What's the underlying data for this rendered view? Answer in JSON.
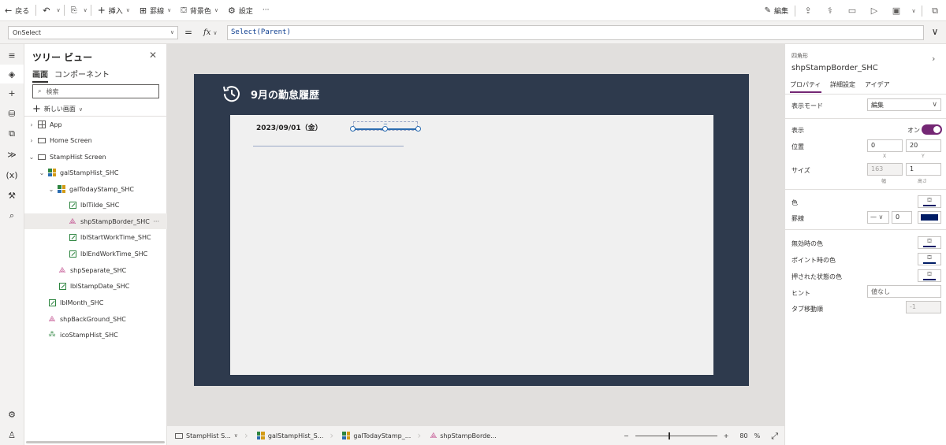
{
  "toolbar": {
    "back": "戻る",
    "insert": "挿入",
    "border": "罫線",
    "background_color": "背景色",
    "settings": "設定",
    "more": "···",
    "edit": "編集"
  },
  "formula_bar": {
    "property": "OnSelect",
    "equals": "=",
    "fx": "fx",
    "formula": "Select(Parent)"
  },
  "tree_view": {
    "title": "ツリー ビュー",
    "tabs": [
      "画面",
      "コンポーネント"
    ],
    "search_placeholder": "検索",
    "new_screen": "新しい画面",
    "items": [
      {
        "label": "App",
        "icon": "app"
      },
      {
        "label": "Home Screen",
        "icon": "screen"
      },
      {
        "label": "StampHist Screen",
        "icon": "screen"
      },
      {
        "label": "galStampHist_SHC",
        "icon": "gallery"
      },
      {
        "label": "galTodayStamp_SHC",
        "icon": "gallery"
      },
      {
        "label": "lblTilde_SHC",
        "icon": "label"
      },
      {
        "label": "shpStampBorder_SHC",
        "icon": "shape",
        "more": "···"
      },
      {
        "label": "lblStartWorkTime_SHC",
        "icon": "label"
      },
      {
        "label": "lblEndWorkTime_SHC",
        "icon": "label"
      },
      {
        "label": "shpSeparate_SHC",
        "icon": "shape"
      },
      {
        "label": "lblStampDate_SHC",
        "icon": "label"
      },
      {
        "label": "lblMonth_SHC",
        "icon": "label"
      },
      {
        "label": "shpBackGround_SHC",
        "icon": "shape"
      },
      {
        "label": "icoStampHist_SHC",
        "icon": "icon"
      }
    ]
  },
  "canvas": {
    "title": "9月の勤怠履歴",
    "stamp_date": "2023/09/01（金）",
    "tilde": "~"
  },
  "breadcrumbs": [
    "StampHist S...",
    "galStampHist_S...",
    "galTodayStamp_...",
    "shpStampBorde..."
  ],
  "zoom": {
    "minus": "−",
    "plus": "+",
    "value": "80",
    "unit": "%"
  },
  "properties": {
    "control_type": "四角形",
    "control_name": "shpStampBorder_SHC",
    "tabs": [
      "プロパティ",
      "詳細設定",
      "アイデア"
    ],
    "display_mode_label": "表示モード",
    "display_mode_value": "編集",
    "visible_label": "表示",
    "visible_state": "オン",
    "position_label": "位置",
    "x_value": "0",
    "y_value": "20",
    "x_caption": "X",
    "y_caption": "Y",
    "size_label": "サイズ",
    "width_value": "163",
    "height_value": "1",
    "width_caption": "幅",
    "height_caption": "高さ",
    "color_label": "色",
    "border_label": "罫線",
    "border_width": "0",
    "border_color": "#001c65",
    "disabled_color_label": "無効時の色",
    "hover_color_label": "ポイント時の色",
    "pressed_color_label": "押された状態の色",
    "tooltip_label": "ヒント",
    "tooltip_value": "値なし",
    "tab_index_label": "タブ移動順",
    "tab_index_value": "-1"
  },
  "colors": {
    "accent": "#742774",
    "screen_bg": "#2e3a4d",
    "selection": "#2b6cb0"
  }
}
